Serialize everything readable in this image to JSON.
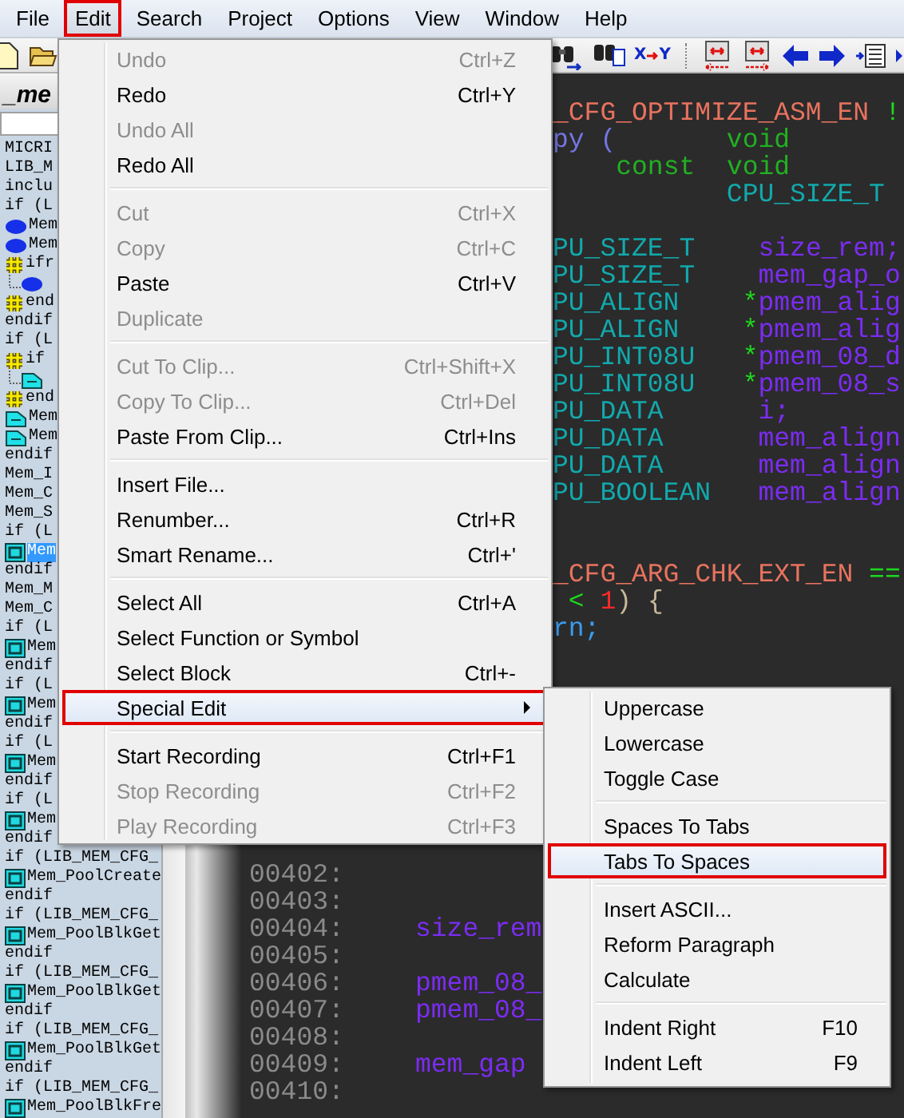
{
  "menubar": [
    {
      "label": "File",
      "selected": false
    },
    {
      "label": "Edit",
      "selected": true
    },
    {
      "label": "Search",
      "selected": false
    },
    {
      "label": "Project",
      "selected": false
    },
    {
      "label": "Options",
      "selected": false
    },
    {
      "label": "View",
      "selected": false
    },
    {
      "label": "Window",
      "selected": false
    },
    {
      "label": "Help",
      "selected": false
    }
  ],
  "toolbar_left": [
    {
      "kind": "new-file"
    },
    {
      "kind": "open-folder"
    }
  ],
  "toolbar_right": [
    {
      "kind": "find"
    },
    {
      "kind": "find-files"
    },
    {
      "kind": "replace",
      "from": "X",
      "to": "Y"
    },
    {
      "kind": "separator"
    },
    {
      "kind": "jump-left"
    },
    {
      "kind": "jump-right"
    },
    {
      "kind": "back"
    },
    {
      "kind": "forward"
    },
    {
      "kind": "indent"
    },
    {
      "kind": "edge"
    }
  ],
  "sidebar": {
    "tab": "_me",
    "items": [
      {
        "text": "MICRI",
        "selected": false
      },
      {
        "text": "LIB_M",
        "selected": false
      },
      {
        "text": "inclu",
        "selected": false
      },
      {
        "text": "if (L",
        "selected": false
      },
      {
        "text": "Mem",
        "kind": "dot",
        "selected": false
      },
      {
        "text": "Mem",
        "kind": "dot",
        "selected": false
      },
      {
        "text": "ifr",
        "kind": "hash",
        "selected": false,
        "children": [
          {
            "kind": "dot"
          }
        ]
      },
      {
        "text": "end",
        "kind": "hash",
        "selected": false
      },
      {
        "text": "endif",
        "selected": false
      },
      {
        "text": "if (L",
        "selected": false
      },
      {
        "text": "if",
        "kind": "hash",
        "selected": false,
        "children": [
          {
            "kind": "folder"
          }
        ]
      },
      {
        "text": "end",
        "kind": "hash",
        "selected": false
      },
      {
        "text": "Mem",
        "kind": "folder",
        "selected": false
      },
      {
        "text": "Mem",
        "kind": "folder",
        "selected": false
      },
      {
        "text": "endif",
        "selected": false
      },
      {
        "text": "Mem_I",
        "selected": false
      },
      {
        "text": "Mem_C",
        "selected": false
      },
      {
        "text": "Mem_S",
        "selected": false
      },
      {
        "text": "if (L",
        "selected": false
      },
      {
        "text": "Mem",
        "kind": "function",
        "selected": true
      },
      {
        "text": "endif",
        "selected": false
      },
      {
        "text": "Mem_M",
        "selected": false
      },
      {
        "text": "Mem_C",
        "selected": false
      },
      {
        "text": "if (L",
        "selected": false
      },
      {
        "text": "Mem",
        "kind": "function",
        "selected": false
      },
      {
        "text": "endif",
        "selected": false
      },
      {
        "text": "if (L",
        "selected": false
      },
      {
        "text": "Mem",
        "kind": "function",
        "selected": false
      },
      {
        "text": "endif",
        "selected": false
      },
      {
        "text": "if (L",
        "selected": false
      },
      {
        "text": "Mem",
        "kind": "function",
        "selected": false
      },
      {
        "text": "endif",
        "selected": false
      },
      {
        "text": "if (L",
        "selected": false
      },
      {
        "text": "Mem",
        "kind": "function",
        "selected": false
      },
      {
        "text": "endif",
        "selected": false
      },
      {
        "text": "if (LIB_MEM_CFG_",
        "selected": false
      },
      {
        "text": "Mem_PoolCreate",
        "kind": "function",
        "selected": false
      },
      {
        "text": "endif",
        "selected": false
      },
      {
        "text": "if (LIB_MEM_CFG_",
        "selected": false
      },
      {
        "text": "Mem_PoolBlkGet",
        "kind": "function",
        "selected": false
      },
      {
        "text": "endif",
        "selected": false
      },
      {
        "text": "if (LIB_MEM_CFG_",
        "selected": false
      },
      {
        "text": "Mem_PoolBlkGet",
        "kind": "function",
        "selected": false
      },
      {
        "text": "endif",
        "selected": false
      },
      {
        "text": "if (LIB_MEM_CFG_",
        "selected": false
      },
      {
        "text": "Mem_PoolBlkGet",
        "kind": "function",
        "selected": false
      },
      {
        "text": "endif",
        "selected": false
      },
      {
        "text": "if (LIB_MEM_CFG_",
        "selected": false
      },
      {
        "text": "Mem_PoolBlkFre",
        "kind": "function",
        "selected": false
      }
    ]
  },
  "code_upper": [
    [
      [
        {
          "text": "_CFG_OPTIMIZE_ASM_EN",
          "kind": "macro"
        },
        {
          "text": " !",
          "kind": "operator"
        }
      ],
      [
        {
          "text": "py (",
          "kind": "func"
        },
        {
          "text": "       void",
          "kind": "type"
        }
      ],
      [
        {
          "text": "    const",
          "kind": "type"
        },
        {
          "text": "  void",
          "kind": "type"
        }
      ],
      [
        {
          "text": "           CPU_SIZE_T",
          "kind": "typedef"
        }
      ]
    ],
    [
      [
        {
          "text": "PU_SIZE_T",
          "kind": "typedef"
        },
        {
          "text": "    size_rem;",
          "kind": "ident"
        }
      ],
      [
        {
          "text": "PU_SIZE_T",
          "kind": "typedef"
        },
        {
          "text": "    mem_gap_o",
          "kind": "ident"
        }
      ],
      [
        {
          "text": "PU_ALIGN",
          "kind": "typedef"
        },
        {
          "text": "    *",
          "kind": "operator"
        },
        {
          "text": "pmem_alig",
          "kind": "ident"
        }
      ],
      [
        {
          "text": "PU_ALIGN",
          "kind": "typedef"
        },
        {
          "text": "    *",
          "kind": "operator"
        },
        {
          "text": "pmem_alig",
          "kind": "ident"
        }
      ],
      [
        {
          "text": "PU_INT08U",
          "kind": "typedef"
        },
        {
          "text": "   *",
          "kind": "operator"
        },
        {
          "text": "pmem_08_d",
          "kind": "ident"
        }
      ],
      [
        {
          "text": "PU_INT08U",
          "kind": "typedef"
        },
        {
          "text": "   *",
          "kind": "operator"
        },
        {
          "text": "pmem_08_s",
          "kind": "ident"
        }
      ],
      [
        {
          "text": "PU_DATA",
          "kind": "typedef"
        },
        {
          "text": "      i;",
          "kind": "ident"
        }
      ],
      [
        {
          "text": "PU_DATA",
          "kind": "typedef"
        },
        {
          "text": "      mem_align",
          "kind": "ident"
        }
      ],
      [
        {
          "text": "PU_DATA",
          "kind": "typedef"
        },
        {
          "text": "      mem_align",
          "kind": "ident"
        }
      ],
      [
        {
          "text": "PU_BOOLEAN",
          "kind": "typedef"
        },
        {
          "text": "   mem_align",
          "kind": "ident"
        }
      ]
    ],
    [
      [
        {
          "text": "_CFG_ARG_CHK_EXT_EN",
          "kind": "macro"
        },
        {
          "text": " ==",
          "kind": "operator"
        }
      ],
      [
        {
          "text": " <",
          "kind": "operator"
        },
        {
          "text": " 1",
          "kind": "number"
        },
        {
          "text": ")",
          "kind": "punct"
        },
        {
          "text": " {",
          "kind": "punct"
        }
      ],
      [
        {
          "text": "rn;",
          "kind": "keyword"
        }
      ]
    ]
  ],
  "code_lower": [
    {
      "number": "00402:"
    },
    {
      "number": "00403:"
    },
    {
      "number": "00404:",
      "tokens": [
        {
          "text": "size_rem",
          "kind": "ident"
        }
      ]
    },
    {
      "number": "00405:"
    },
    {
      "number": "00406:",
      "tokens": [
        {
          "text": "pmem_08_",
          "kind": "ident"
        }
      ]
    },
    {
      "number": "00407:",
      "tokens": [
        {
          "text": "pmem_08_",
          "kind": "ident"
        }
      ]
    },
    {
      "number": "00408:"
    },
    {
      "number": "00409:",
      "tokens": [
        {
          "text": "mem_gap",
          "kind": "ident"
        }
      ]
    },
    {
      "number": "00410:"
    }
  ],
  "edit_menu": {
    "groups": [
      {
        "items": [
          {
            "label": "Undo",
            "shortcut": "Ctrl+Z",
            "submenu": false,
            "disabled": true,
            "selected": false
          },
          {
            "label": "Redo",
            "shortcut": "Ctrl+Y",
            "submenu": false,
            "disabled": false,
            "selected": false
          },
          {
            "label": "Undo All",
            "submenu": false,
            "disabled": true,
            "selected": false
          },
          {
            "label": "Redo All",
            "submenu": false,
            "disabled": false,
            "selected": false
          }
        ]
      },
      {
        "items": [
          {
            "label": "Cut",
            "shortcut": "Ctrl+X",
            "submenu": false,
            "disabled": true,
            "selected": false
          },
          {
            "label": "Copy",
            "shortcut": "Ctrl+C",
            "submenu": false,
            "disabled": true,
            "selected": false
          },
          {
            "label": "Paste",
            "shortcut": "Ctrl+V",
            "submenu": false,
            "disabled": false,
            "selected": false
          },
          {
            "label": "Duplicate",
            "submenu": false,
            "disabled": true,
            "selected": false
          }
        ]
      },
      {
        "items": [
          {
            "label": "Cut To Clip...",
            "shortcut": "Ctrl+Shift+X",
            "submenu": false,
            "disabled": true,
            "selected": false
          },
          {
            "label": "Copy To Clip...",
            "shortcut": "Ctrl+Del",
            "submenu": false,
            "disabled": true,
            "selected": false
          },
          {
            "label": "Paste From Clip...",
            "shortcut": "Ctrl+Ins",
            "submenu": false,
            "disabled": false,
            "selected": false
          }
        ]
      },
      {
        "items": [
          {
            "label": "Insert File...",
            "submenu": false,
            "disabled": false,
            "selected": false
          },
          {
            "label": "Renumber...",
            "shortcut": "Ctrl+R",
            "submenu": false,
            "disabled": false,
            "selected": false
          },
          {
            "label": "Smart Rename...",
            "shortcut": "Ctrl+'",
            "submenu": false,
            "disabled": false,
            "selected": false
          }
        ]
      },
      {
        "items": [
          {
            "label": "Select All",
            "shortcut": "Ctrl+A",
            "submenu": false,
            "disabled": false,
            "selected": false
          },
          {
            "label": "Select Function or Symbol",
            "submenu": false,
            "disabled": false,
            "selected": false
          },
          {
            "label": "Select Block",
            "shortcut": "Ctrl+-",
            "submenu": false,
            "disabled": false,
            "selected": false
          },
          {
            "label": "Special Edit",
            "submenu": true,
            "disabled": false,
            "selected": true
          }
        ]
      },
      {
        "items": [
          {
            "label": "Start Recording",
            "shortcut": "Ctrl+F1",
            "submenu": false,
            "disabled": false,
            "selected": false
          },
          {
            "label": "Stop Recording",
            "shortcut": "Ctrl+F2",
            "submenu": false,
            "disabled": true,
            "selected": false
          },
          {
            "label": "Play Recording",
            "shortcut": "Ctrl+F3",
            "submenu": false,
            "disabled": true,
            "selected": false
          }
        ]
      }
    ]
  },
  "special_edit_menu": {
    "groups": [
      {
        "items": [
          {
            "label": "Uppercase",
            "submenu": false,
            "disabled": false,
            "selected": false
          },
          {
            "label": "Lowercase",
            "submenu": false,
            "disabled": false,
            "selected": false
          },
          {
            "label": "Toggle Case",
            "submenu": false,
            "disabled": false,
            "selected": false
          }
        ]
      },
      {
        "items": [
          {
            "label": "Spaces To Tabs",
            "submenu": false,
            "disabled": false,
            "selected": false
          },
          {
            "label": "Tabs To Spaces",
            "submenu": false,
            "disabled": false,
            "selected": true
          }
        ]
      },
      {
        "items": [
          {
            "label": "Insert ASCII...",
            "submenu": false,
            "disabled": false,
            "selected": false
          },
          {
            "label": "Reform Paragraph",
            "submenu": false,
            "disabled": false,
            "selected": false
          },
          {
            "label": "Calculate",
            "submenu": false,
            "disabled": false,
            "selected": false
          }
        ]
      },
      {
        "items": [
          {
            "label": "Indent Right",
            "shortcut": "F10",
            "submenu": false,
            "disabled": false,
            "selected": false
          },
          {
            "label": "Indent Left",
            "shortcut": "F9",
            "submenu": false,
            "disabled": false,
            "selected": false
          }
        ]
      }
    ]
  }
}
